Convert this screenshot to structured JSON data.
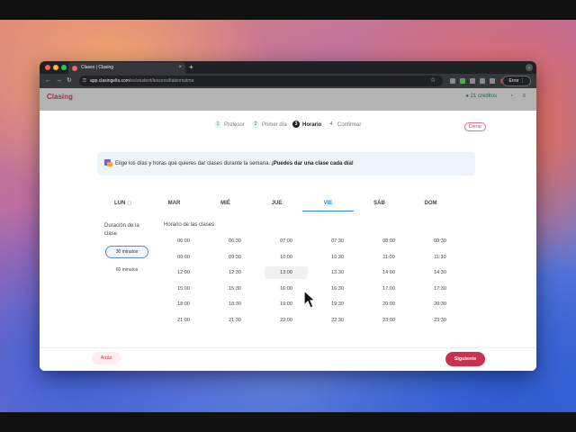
{
  "browser": {
    "tab_title": "Clases | Clasing",
    "new_tab_glyph": "+",
    "url_host": "app.clasingelts.com",
    "url_path": "/es/student/lessons/ltabinmatme",
    "error_label": "Error",
    "icons": [
      "back-icon",
      "forward-icon",
      "reload-icon",
      "lock-icon",
      "star-icon",
      "extension-icon",
      "menu-icon"
    ]
  },
  "app": {
    "logo": "Clasing",
    "credits": "21 créditos"
  },
  "stepper": {
    "steps": [
      {
        "num": "1",
        "label": "Profesor",
        "state": "done"
      },
      {
        "num": "2",
        "label": "Primer día",
        "state": "done"
      },
      {
        "num": "3",
        "label": "Horario",
        "state": "active"
      },
      {
        "num": "4",
        "label": "Confirmar",
        "state": "pending"
      }
    ],
    "close_label": "Cerrar"
  },
  "info": {
    "text": "Elige los días y horas que quieres dar clases durante la semana. ",
    "bold": "¡Puedes dar una clase cada día!"
  },
  "days": [
    "LUN",
    "MAR",
    "MIÉ",
    "JUE",
    "VIE",
    "SÁB",
    "DOM"
  ],
  "selected_day": "VIE",
  "duration": {
    "title": "Duración de la clase",
    "options": [
      "30 minutos",
      "60 minutos"
    ],
    "selected": "30 minutos"
  },
  "schedule": {
    "title": "Horario de las clases",
    "columns": [
      [
        "06:00",
        "09:00",
        "12:00",
        "15:00",
        "18:00",
        "21:00"
      ],
      [
        "06:30",
        "09:30",
        "12:30",
        "15:30",
        "18:30",
        "21:30"
      ],
      [
        "07:00",
        "10:00",
        "13:00",
        "16:00",
        "19:00",
        "22:00"
      ],
      [
        "07:30",
        "10:30",
        "13:30",
        "16:30",
        "19:30",
        "22:30"
      ],
      [
        "08:00",
        "11:00",
        "14:00",
        "17:00",
        "20:00",
        "23:00"
      ],
      [
        "08:30",
        "11:30",
        "14:30",
        "17:30",
        "20:30",
        "23:30"
      ]
    ],
    "hovered": "13:00"
  },
  "footer": {
    "back_label": "Atrás",
    "next_label": "Siguiente"
  },
  "colors": {
    "brand": "#d6375a",
    "primary_button": "#c8324f",
    "accent": "#2e86c1",
    "credits": "#1e8e5a"
  }
}
